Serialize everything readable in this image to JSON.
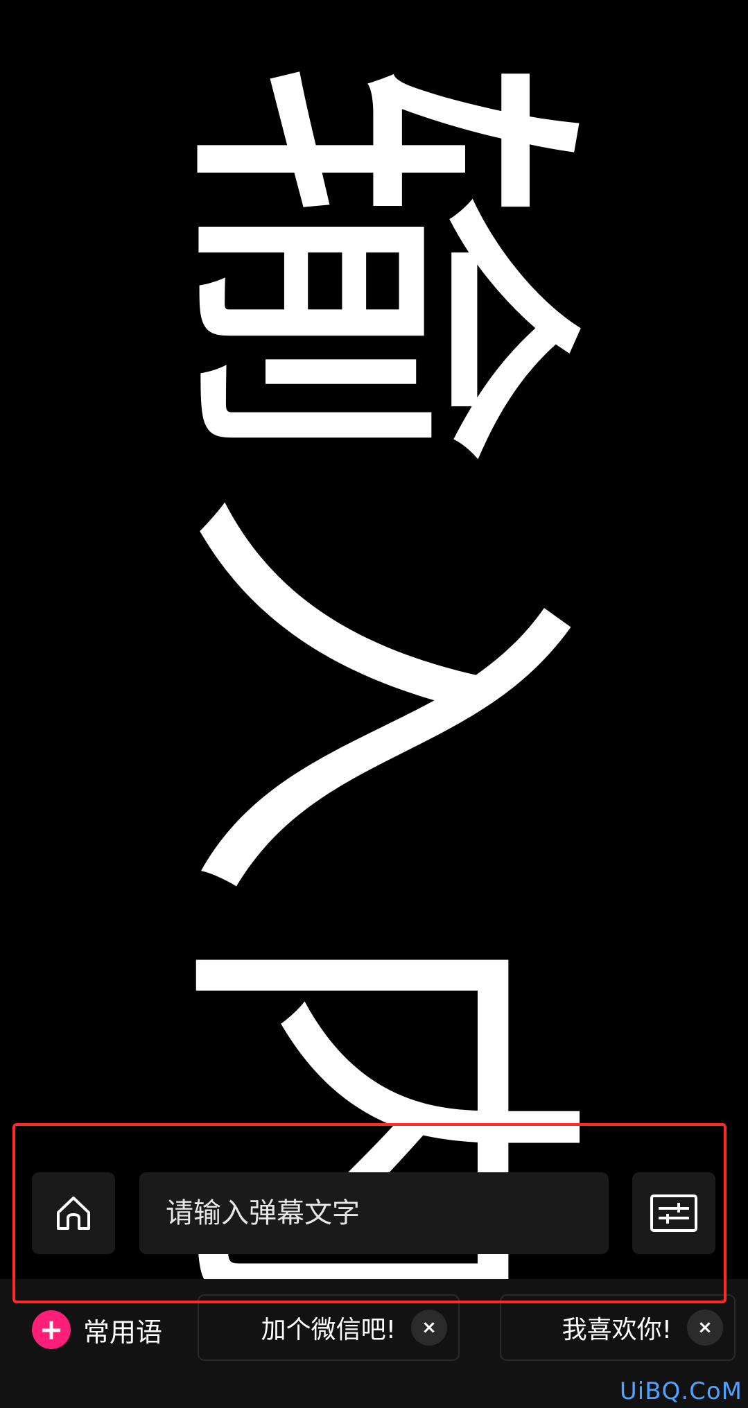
{
  "danmaku": {
    "chars": [
      "输",
      "入",
      "内"
    ]
  },
  "input": {
    "placeholder": "请输入弹幕文字"
  },
  "toolbar": {
    "home_icon": "home-icon",
    "settings_icon": "sliders-icon"
  },
  "phrases": {
    "add_label": "常用语",
    "items": [
      {
        "text": "加个微信吧!"
      },
      {
        "text": "我喜欢你!"
      }
    ],
    "remove_symbol": "×"
  },
  "watermark": "UiBQ.CoM",
  "colors": {
    "accent": "#ff1e78",
    "highlight": "#ff2a2a",
    "background": "#000000"
  }
}
